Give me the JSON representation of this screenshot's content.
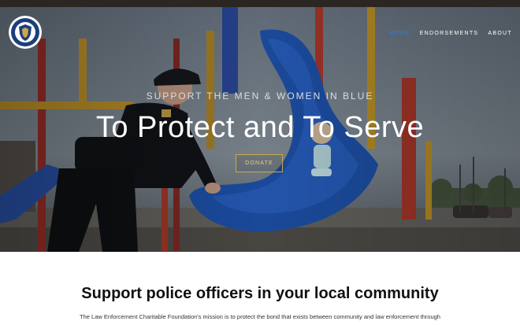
{
  "nav": {
    "items": [
      {
        "label": "HOME",
        "active": true
      },
      {
        "label": "ENDORSEMENTS",
        "active": false
      },
      {
        "label": "ABOUT",
        "active": false
      }
    ]
  },
  "hero": {
    "subtitle": "SUPPORT THE MEN & WOMEN IN BLUE",
    "headline": "To Protect and To Serve",
    "donate_label": "DONATE"
  },
  "intro": {
    "heading": "Support police officers in your local community",
    "body": "The Law Enforcement Charitable Foundation's mission is to protect the bond that exists between community and law enforcement through"
  },
  "colors": {
    "nav_active": "#2e7fd6",
    "donate_border": "#c9a94e",
    "slide_blue": "#1f56b4"
  }
}
